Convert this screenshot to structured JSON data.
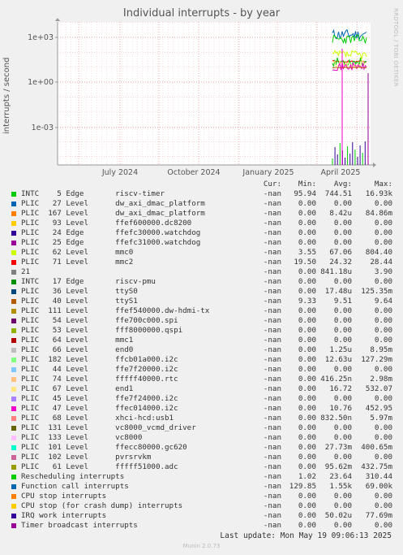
{
  "chart_data": {
    "type": "line",
    "title": "Individual interrupts - by year",
    "ylabel": "interrupts / second",
    "yscale": "log",
    "y_ticks": [
      "1e+03",
      "1e+00",
      "1e-03"
    ],
    "x_ticks": [
      "July 2024",
      "October 2024",
      "January 2025",
      "April 2025"
    ],
    "grid": true,
    "columns": [
      "Cur:",
      "Min:",
      "Avg:",
      "Max:"
    ],
    "series": [
      {
        "name": "INTC    5 Edge       riscv-timer",
        "color": "#00cc00",
        "cur": "-nan",
        "min": "95.94",
        "avg": "744.51",
        "max": "16.93k"
      },
      {
        "name": "PLIC   27 Level      dw_axi_dmac_platform",
        "color": "#0066b3",
        "cur": "-nan",
        "min": "0.00",
        "avg": "0.00",
        "max": "0.00"
      },
      {
        "name": "PLIC  167 Level      dw_axi_dmac_platform",
        "color": "#ff8000",
        "cur": "-nan",
        "min": "0.00",
        "avg": "8.42u",
        "max": "84.86m"
      },
      {
        "name": "PLIC   93 Level      ffef600000.dc8200",
        "color": "#ffcc00",
        "cur": "-nan",
        "min": "0.00",
        "avg": "0.00",
        "max": "0.00"
      },
      {
        "name": "PLIC   24 Edge       ffefc30000.watchdog",
        "color": "#330099",
        "cur": "-nan",
        "min": "0.00",
        "avg": "0.00",
        "max": "0.00"
      },
      {
        "name": "PLIC   25 Edge       ffefc31000.watchdog",
        "color": "#990099",
        "cur": "-nan",
        "min": "0.00",
        "avg": "0.00",
        "max": "0.00"
      },
      {
        "name": "PLIC   62 Level      mmc0",
        "color": "#ccff00",
        "cur": "-nan",
        "min": "3.55",
        "avg": "67.06",
        "max": "804.40"
      },
      {
        "name": "PLIC   71 Level      mmc2",
        "color": "#ff0000",
        "cur": "-nan",
        "min": "19.50",
        "avg": "24.32",
        "max": "28.44"
      },
      {
        "name": "21",
        "color": "#808080",
        "cur": "-nan",
        "min": "0.00",
        "avg": "841.18u",
        "max": "3.90"
      },
      {
        "name": "INTC   17 Edge       riscv-pmu",
        "color": "#008f00",
        "cur": "-nan",
        "min": "0.00",
        "avg": "0.00",
        "max": "0.00"
      },
      {
        "name": "PLIC   36 Level      ttyS0",
        "color": "#00487d",
        "cur": "-nan",
        "min": "0.00",
        "avg": "17.48u",
        "max": "125.35m"
      },
      {
        "name": "PLIC   40 Level      ttyS1",
        "color": "#b35a00",
        "cur": "-nan",
        "min": "9.33",
        "avg": "9.51",
        "max": "9.64"
      },
      {
        "name": "PLIC  111 Level      ffef540000.dw-hdmi-tx",
        "color": "#b38f00",
        "cur": "-nan",
        "min": "0.00",
        "avg": "0.00",
        "max": "0.00"
      },
      {
        "name": "PLIC   54 Level      ffe700c000.spi",
        "color": "#6b006b",
        "cur": "-nan",
        "min": "0.00",
        "avg": "0.00",
        "max": "0.00"
      },
      {
        "name": "PLIC   53 Level      fff8000000.qspi",
        "color": "#8fb300",
        "cur": "-nan",
        "min": "0.00",
        "avg": "0.00",
        "max": "0.00"
      },
      {
        "name": "PLIC   64 Level      mmc1",
        "color": "#b30000",
        "cur": "-nan",
        "min": "0.00",
        "avg": "0.00",
        "max": "0.00"
      },
      {
        "name": "PLIC   66 Level      end0",
        "color": "#bebebe",
        "cur": "-nan",
        "min": "0.00",
        "avg": "1.25u",
        "max": "8.95m"
      },
      {
        "name": "PLIC  182 Level      ffcb01a000.i2c",
        "color": "#80ff80",
        "cur": "-nan",
        "min": "0.00",
        "avg": "12.63u",
        "max": "127.29m"
      },
      {
        "name": "PLIC   44 Level      ffe7f20000.i2c",
        "color": "#80c9ff",
        "cur": "-nan",
        "min": "0.00",
        "avg": "0.00",
        "max": "0.00"
      },
      {
        "name": "PLIC   74 Level      fffff40000.rtc",
        "color": "#ffc080",
        "cur": "-nan",
        "min": "0.00",
        "avg": "416.25n",
        "max": "2.98m"
      },
      {
        "name": "PLIC   67 Level      end1",
        "color": "#ffe680",
        "cur": "-nan",
        "min": "0.00",
        "avg": "16.72",
        "max": "532.07"
      },
      {
        "name": "PLIC   45 Level      ffe7f24000.i2c",
        "color": "#aa80ff",
        "cur": "-nan",
        "min": "0.00",
        "avg": "0.00",
        "max": "0.00"
      },
      {
        "name": "PLIC   47 Level      ffec014000.i2c",
        "color": "#ee00cc",
        "cur": "-nan",
        "min": "0.00",
        "avg": "10.76",
        "max": "452.95"
      },
      {
        "name": "PLIC   68 Level      xhci-hcd:usb1",
        "color": "#ff8080",
        "cur": "-nan",
        "min": "0.00",
        "avg": "832.50n",
        "max": "5.97m"
      },
      {
        "name": "PLIC  131 Level      vc8000_vcmd_driver",
        "color": "#666600",
        "cur": "-nan",
        "min": "0.00",
        "avg": "0.00",
        "max": "0.00"
      },
      {
        "name": "PLIC  133 Level      vc8000",
        "color": "#ffbfff",
        "cur": "-nan",
        "min": "0.00",
        "avg": "0.00",
        "max": "0.00"
      },
      {
        "name": "PLIC  101 Level      ffecc80000.gc620",
        "color": "#00ffcc",
        "cur": "-nan",
        "min": "0.00",
        "avg": "27.73m",
        "max": "400.65m"
      },
      {
        "name": "PLIC  102 Level      pvrsrvkm",
        "color": "#cc6699",
        "cur": "-nan",
        "min": "0.00",
        "avg": "0.00",
        "max": "0.00"
      },
      {
        "name": "PLIC   61 Level      fffff51000.adc",
        "color": "#999900",
        "cur": "-nan",
        "min": "0.00",
        "avg": "95.62m",
        "max": "432.75m"
      },
      {
        "name": "Rescheduling interrupts",
        "color": "#00cc00",
        "cur": "-nan",
        "min": "1.02",
        "avg": "23.64",
        "max": "310.44"
      },
      {
        "name": "Function call interrupts",
        "color": "#0066b3",
        "cur": "-nan",
        "min": "129.85",
        "avg": "1.55k",
        "max": "69.00k"
      },
      {
        "name": "CPU stop interrupts",
        "color": "#ff8000",
        "cur": "-nan",
        "min": "0.00",
        "avg": "0.00",
        "max": "0.00"
      },
      {
        "name": "CPU stop (for crash dump) interrupts",
        "color": "#ffcc00",
        "cur": "-nan",
        "min": "0.00",
        "avg": "0.00",
        "max": "0.00"
      },
      {
        "name": "IRQ work interrupts",
        "color": "#330099",
        "cur": "-nan",
        "min": "0.00",
        "avg": "50.02u",
        "max": "77.69m"
      },
      {
        "name": "Timer broadcast interrupts",
        "color": "#990099",
        "cur": "-nan",
        "min": "0.00",
        "avg": "0.00",
        "max": "0.00"
      }
    ]
  },
  "footer": {
    "last_update": "Last update: Mon May 19 09:06:13 2025",
    "munin": "Munin 2.0.73",
    "watermark": "RRDTOOL / TOBI OETIKER"
  }
}
